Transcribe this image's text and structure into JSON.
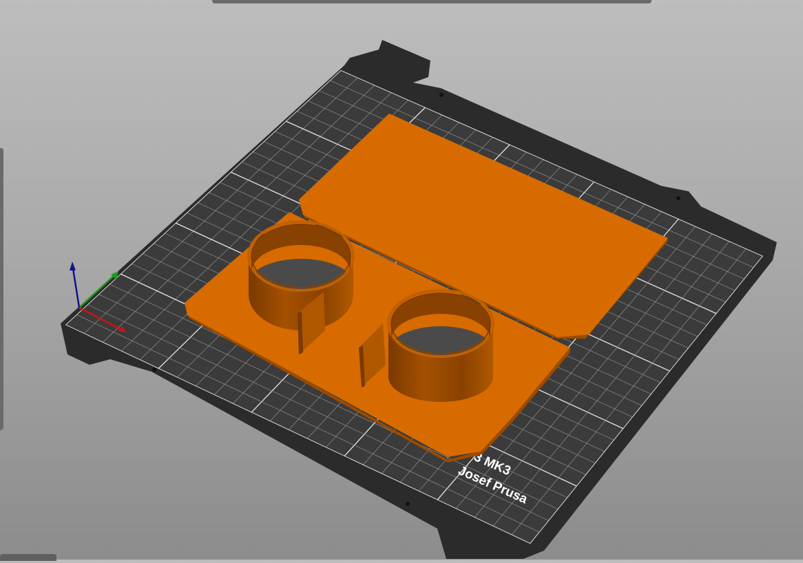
{
  "scene": {
    "bed_label_line1": "3 MK3",
    "bed_label_line2": "Josef Prusa",
    "colors": {
      "background_top": "#bdbdbd",
      "background_bottom": "#8c8c8c",
      "bed_frame": "#2b2b2b",
      "bed_surface": "#3b3b3b",
      "grid_line": "#d8d8d8",
      "object_top": "#d76b00",
      "object_side": "#9b4b00",
      "axis_x": "#c8141a",
      "axis_y": "#1f9a1f",
      "axis_z": "#13138f"
    },
    "icons": [
      "axis-x-icon",
      "axis-y-icon",
      "axis-z-icon"
    ]
  }
}
